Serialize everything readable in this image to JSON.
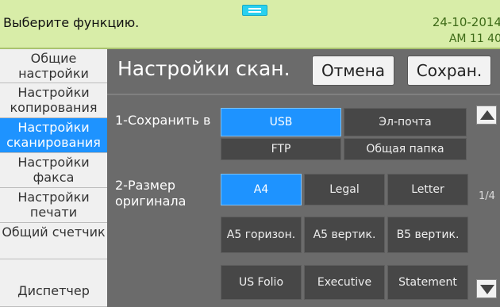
{
  "topbar": {
    "prompt": "Выберите функцию.",
    "date": "24-10-2014",
    "time": "AM 11  40"
  },
  "sidebar": {
    "items": [
      {
        "label": "Общие настройки",
        "active": false
      },
      {
        "label": "Настройки копирования",
        "active": false
      },
      {
        "label": "Настройки сканирования",
        "active": true
      },
      {
        "label": "Настройки факса",
        "active": false
      },
      {
        "label": "Настройки печати",
        "active": false
      },
      {
        "label": "Общий счетчик",
        "active": false
      },
      {
        "label": "Диспетчер",
        "active": false
      }
    ]
  },
  "main": {
    "title": "Настройки скан.",
    "cancel_label": "Отмена",
    "save_label": "Сохран.",
    "save_to": {
      "label": "1-Сохранить в",
      "options": [
        "USB",
        "Эл-почта",
        "FTP",
        "Общая папка"
      ],
      "selected": "USB"
    },
    "original_size": {
      "label": "2-Размер оригинала",
      "options": [
        "A4",
        "Legal",
        "Letter",
        "A5 горизон.",
        "A5 вертик.",
        "B5 вертик.",
        "US Folio",
        "Executive",
        "Statement"
      ],
      "selected": "A4"
    },
    "page_indicator": "1/4"
  },
  "colors": {
    "accent": "#1e93ff",
    "topbar_bg": "#d8eda8",
    "panel_bg": "#6b6b6b"
  },
  "icons": [
    "scroll-up-icon",
    "scroll-down-icon",
    "drag-handle-icon"
  ]
}
